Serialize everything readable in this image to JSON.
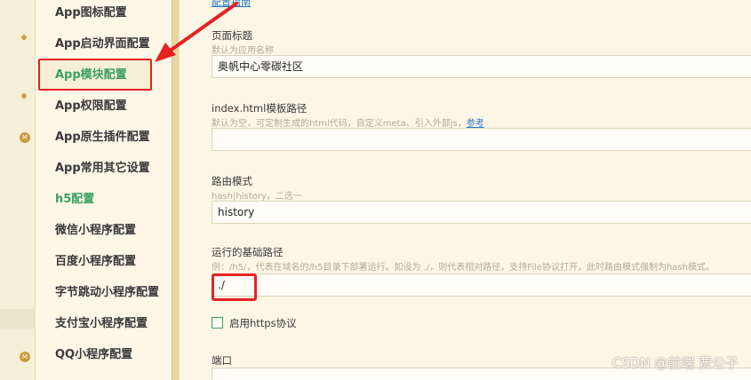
{
  "sidebar": {
    "items": [
      {
        "label": "App图标配置",
        "style": "normal"
      },
      {
        "label": "App启动界面配置",
        "style": "normal"
      },
      {
        "label": "App模块配置",
        "style": "green"
      },
      {
        "label": "App权限配置",
        "style": "normal"
      },
      {
        "label": "App原生插件配置",
        "style": "normal"
      },
      {
        "label": "App常用其它设置",
        "style": "normal"
      },
      {
        "label": "h5配置",
        "style": "green"
      },
      {
        "label": "微信小程序配置",
        "style": "normal"
      },
      {
        "label": "百度小程序配置",
        "style": "normal"
      },
      {
        "label": "字节跳动小程序配置",
        "style": "normal"
      },
      {
        "label": "支付宝小程序配置",
        "style": "normal"
      },
      {
        "label": "QQ小程序配置",
        "style": "normal"
      }
    ],
    "gutter_badge": "M"
  },
  "form": {
    "top_link": "配置指南",
    "page_title": {
      "label": "页面标题",
      "hint": "默认为应用名称",
      "value": "奥帆中心零碳社区"
    },
    "template_path": {
      "label": "index.html模板路径",
      "hint": "默认为空，可定制生成的html代码，自定义meta、引入外部js，",
      "hint_link": "参考",
      "value": ""
    },
    "router_mode": {
      "label": "路由模式",
      "hint": "hash|history，二选一",
      "value": "history"
    },
    "base_path": {
      "label": "运行的基础路径",
      "hint": "例：/h5/，代表在域名的/h5目录下部署运行。如设为 ./，则代表相对路径，支持File协议打开，此时路由模式强制为hash模式。",
      "value": "./"
    },
    "https": {
      "label": "启用https协议",
      "checked": false
    },
    "port": {
      "label": "端口",
      "value": ""
    }
  },
  "watermark": "CSDN @前端 贾公子",
  "colors": {
    "accent_green": "#3aa15f",
    "highlight_red": "#e52222",
    "link_blue": "#2979c9",
    "background": "#fbf6e6"
  }
}
